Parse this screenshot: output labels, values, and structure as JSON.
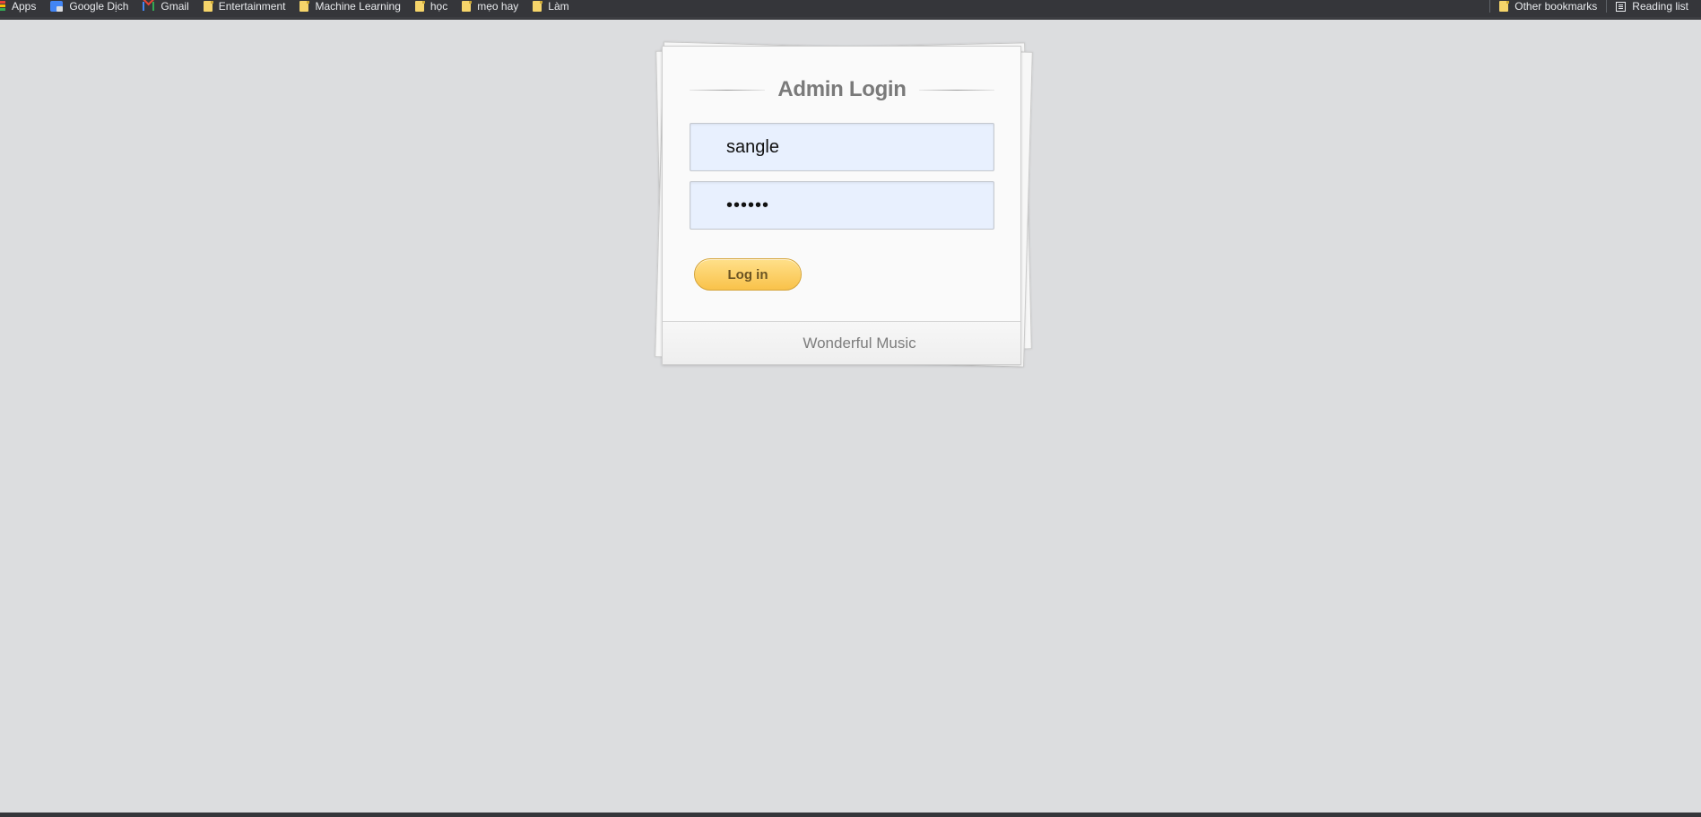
{
  "bookmarks_bar": {
    "left_items": [
      {
        "label": "Apps",
        "icon": "apps-icon"
      },
      {
        "label": "Google Dịch",
        "icon": "google-translate-icon"
      },
      {
        "label": "Gmail",
        "icon": "gmail-icon"
      },
      {
        "label": "Entertainment",
        "icon": "folder-icon"
      },
      {
        "label": "Machine Learning",
        "icon": "folder-icon"
      },
      {
        "label": "học",
        "icon": "folder-icon"
      },
      {
        "label": "mẹo hay",
        "icon": "folder-icon"
      },
      {
        "label": "Làm",
        "icon": "folder-icon"
      }
    ],
    "right_items": [
      {
        "label": "Other bookmarks",
        "icon": "folder-icon"
      },
      {
        "label": "Reading list",
        "icon": "reading-list-icon"
      }
    ]
  },
  "login": {
    "title": "Admin Login",
    "username_value": "sangle",
    "password_value": "••••••",
    "login_button_label": "Log in",
    "footer_text": "Wonderful Music"
  },
  "colors": {
    "page_background": "#dcdddf",
    "bookmarks_bar_background": "#35363a",
    "input_background": "#e8f0fe",
    "button_gradient_top": "#ffe08a",
    "button_gradient_bottom": "#f9c24a"
  }
}
